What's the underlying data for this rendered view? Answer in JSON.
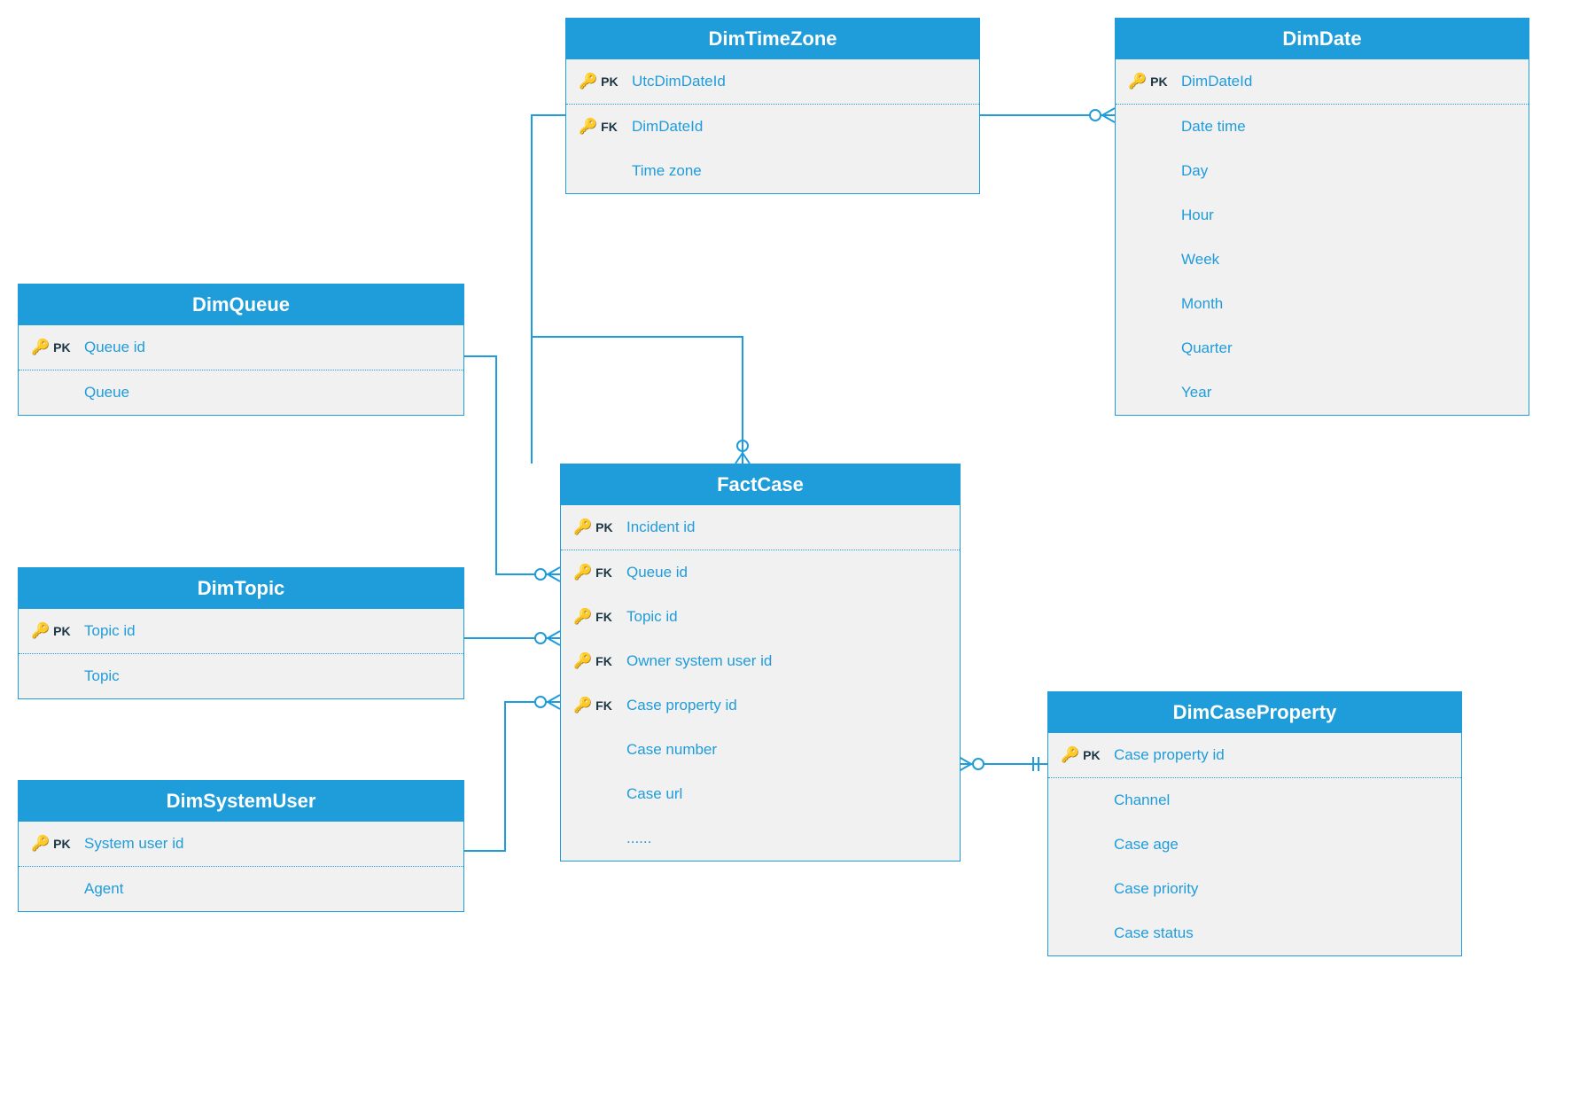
{
  "colors": {
    "accent": "#1f9cda",
    "text": "#1b3544",
    "panel": "#f1f1f1"
  },
  "entities": {
    "dimTimeZone": {
      "title": "DimTimeZone",
      "rows": [
        {
          "key": "PK",
          "label": "UtcDimDateId"
        },
        {
          "key": "FK",
          "label": "DimDateId"
        },
        {
          "key": "",
          "label": "Time zone"
        }
      ]
    },
    "dimDate": {
      "title": "DimDate",
      "rows": [
        {
          "key": "PK",
          "label": "DimDateId"
        },
        {
          "key": "",
          "label": "Date time"
        },
        {
          "key": "",
          "label": "Day"
        },
        {
          "key": "",
          "label": "Hour"
        },
        {
          "key": "",
          "label": "Week"
        },
        {
          "key": "",
          "label": "Month"
        },
        {
          "key": "",
          "label": "Quarter"
        },
        {
          "key": "",
          "label": "Year"
        }
      ]
    },
    "dimQueue": {
      "title": "DimQueue",
      "rows": [
        {
          "key": "PK",
          "label": "Queue id"
        },
        {
          "key": "",
          "label": "Queue"
        }
      ]
    },
    "dimTopic": {
      "title": "DimTopic",
      "rows": [
        {
          "key": "PK",
          "label": "Topic id"
        },
        {
          "key": "",
          "label": "Topic"
        }
      ]
    },
    "dimSystemUser": {
      "title": "DimSystemUser",
      "rows": [
        {
          "key": "PK",
          "label": "System user id"
        },
        {
          "key": "",
          "label": "Agent"
        }
      ]
    },
    "factCase": {
      "title": "FactCase",
      "rows": [
        {
          "key": "PK",
          "label": "Incident id"
        },
        {
          "key": "FK",
          "label": "Queue id"
        },
        {
          "key": "FK",
          "label": "Topic id"
        },
        {
          "key": "FK",
          "label": "Owner system user id"
        },
        {
          "key": "FK",
          "label": "Case property id"
        },
        {
          "key": "",
          "label": "Case number"
        },
        {
          "key": "",
          "label": "Case url"
        },
        {
          "key": "",
          "label": "......"
        }
      ]
    },
    "dimCaseProperty": {
      "title": "DimCaseProperty",
      "rows": [
        {
          "key": "PK",
          "label": "Case property id"
        },
        {
          "key": "",
          "label": "Channel"
        },
        {
          "key": "",
          "label": "Case age"
        },
        {
          "key": "",
          "label": "Case priority"
        },
        {
          "key": "",
          "label": "Case status"
        }
      ]
    }
  }
}
